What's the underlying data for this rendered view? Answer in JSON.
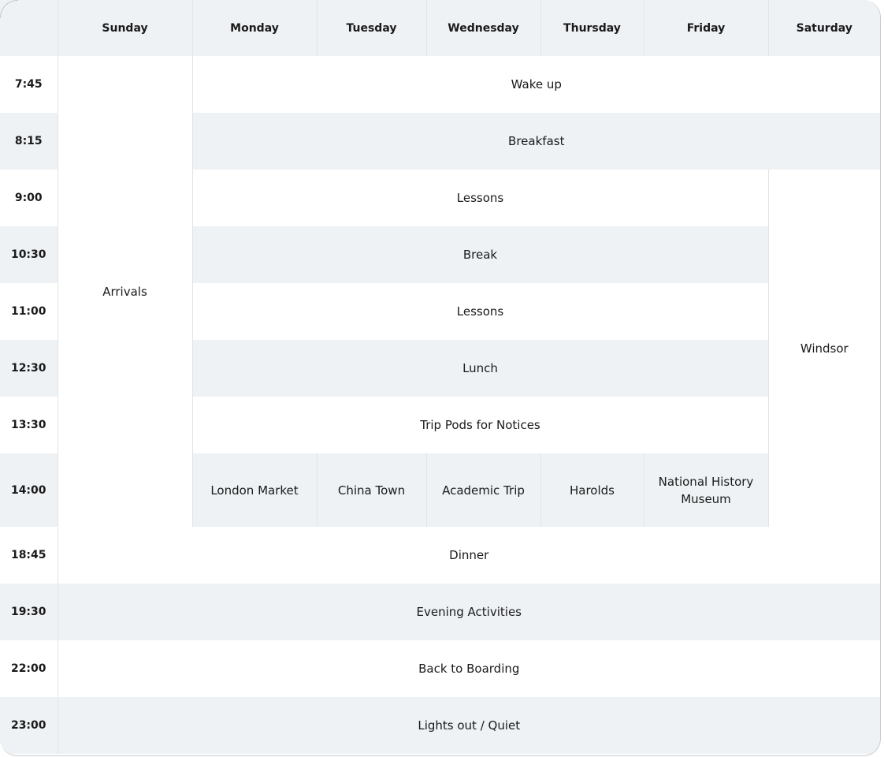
{
  "header": {
    "time_col": "",
    "days": [
      "Sunday",
      "Monday",
      "Tuesday",
      "Wednesday",
      "Thursday",
      "Friday",
      "Saturday"
    ]
  },
  "spans": {
    "sunday": "Arrivals",
    "saturday": "Windsor"
  },
  "rows": [
    {
      "time": "7:45",
      "activity": "Wake up"
    },
    {
      "time": "8:15",
      "activity": "Breakfast"
    },
    {
      "time": "9:00",
      "activity": "Lessons"
    },
    {
      "time": "10:30",
      "activity": "Break"
    },
    {
      "time": "11:00",
      "activity": "Lessons"
    },
    {
      "time": "12:30",
      "activity": "Lunch"
    },
    {
      "time": "13:30",
      "activity": "Trip Pods for Notices"
    },
    {
      "time": "14:00",
      "trips": [
        "London Market",
        "China Town",
        "Academic Trip",
        "Harolds",
        "National History Museum"
      ]
    },
    {
      "time": "18:45",
      "activity": "Dinner"
    },
    {
      "time": "19:30",
      "activity": "Evening Activities"
    },
    {
      "time": "22:00",
      "activity": "Back to Boarding"
    },
    {
      "time": "23:00",
      "activity": "Lights out / Quiet"
    }
  ]
}
